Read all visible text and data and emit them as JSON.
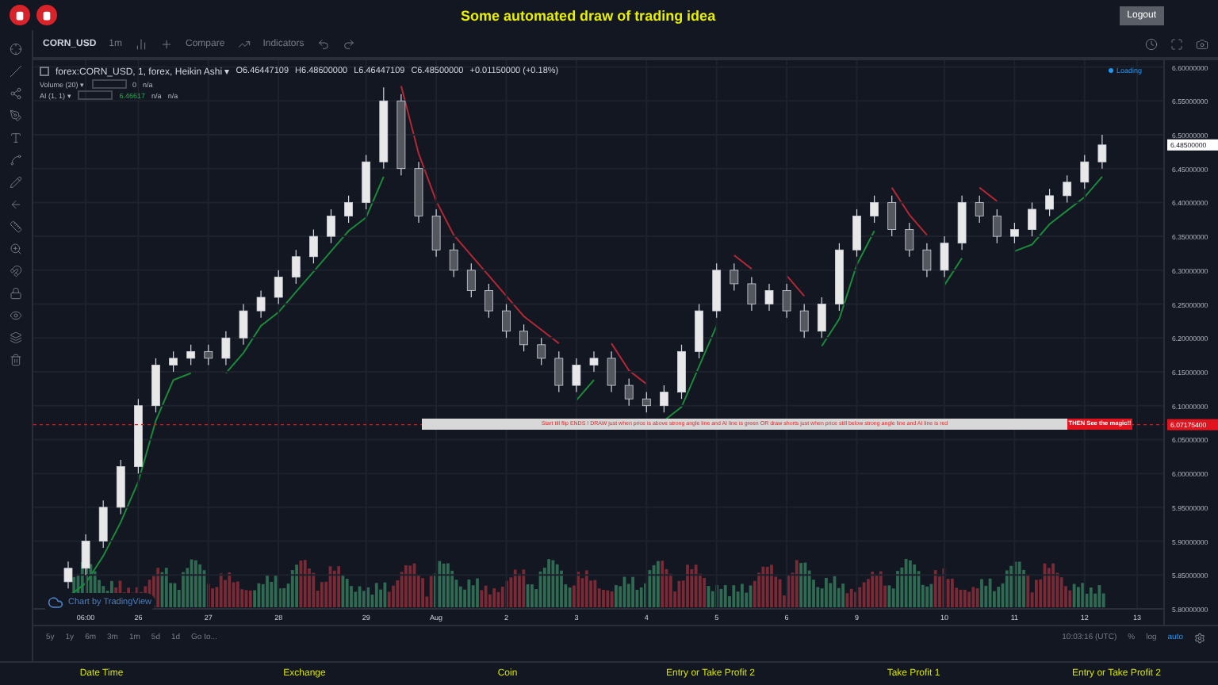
{
  "header": {
    "title": "Some automated draw of trading idea",
    "logout": "Logout"
  },
  "chart_toolbar": {
    "symbol": "CORN_USD",
    "interval": "1m",
    "compare": "Compare",
    "indicators": "Indicators"
  },
  "legend": {
    "series": "forex:CORN_USD, 1, forex, Heikin Ashi ▾",
    "open": "O6.46447109",
    "high": "H6.48600000",
    "low": "L6.46447109",
    "close": "C6.48500000",
    "change": "+0.01150000 (+0.18%)",
    "studies": [
      {
        "name": "Volume (20) ▾",
        "values": [
          "0",
          "n/a"
        ]
      },
      {
        "name": "AI (1, 1) ▾",
        "values": [
          "6.46617",
          "n/a",
          "n/a"
        ]
      }
    ]
  },
  "loading": "Loading",
  "chart": {
    "chart_data": {
      "type": "candlestick",
      "grid": true,
      "ylim": [
        5.8,
        6.61
      ],
      "categories": [
        null,
        "06:00",
        null,
        null,
        "26",
        null,
        null,
        null,
        "27",
        null,
        null,
        null,
        "28",
        null,
        null,
        null,
        null,
        "29",
        null,
        null,
        null,
        "Aug",
        null,
        null,
        null,
        "2",
        null,
        null,
        null,
        "3",
        null,
        null,
        null,
        "4",
        null,
        null,
        null,
        "5",
        null,
        null,
        null,
        "6",
        null,
        null,
        null,
        "9",
        null,
        null,
        null,
        null,
        "10",
        null,
        null,
        null,
        "11",
        null,
        null,
        null,
        "12",
        null,
        null,
        "13"
      ],
      "yticks": [
        {
          "value": 6.6,
          "label": "6.60000000"
        },
        {
          "value": 6.55,
          "label": "6.55000000"
        },
        {
          "value": 6.5,
          "label": "6.50000000"
        },
        {
          "value": 6.45,
          "label": "6.45000000"
        },
        {
          "value": 6.4,
          "label": "6.40000000"
        },
        {
          "value": 6.35,
          "label": "6.35000000"
        },
        {
          "value": 6.3,
          "label": "6.30000000"
        },
        {
          "value": 6.25,
          "label": "6.25000000"
        },
        {
          "value": 6.2,
          "label": "6.20000000"
        },
        {
          "value": 6.15,
          "label": "6.15000000"
        },
        {
          "value": 6.1,
          "label": "6.10000000"
        },
        {
          "value": 6.05,
          "label": "6.05000000"
        },
        {
          "value": 6.0,
          "label": "6.00000000"
        },
        {
          "value": 5.95,
          "label": "5.95000000"
        },
        {
          "value": 5.9,
          "label": "5.90000000"
        },
        {
          "value": 5.85,
          "label": "5.85000000"
        },
        {
          "value": 5.8,
          "label": "5.80000000"
        }
      ],
      "ohlc": [
        [
          5.84,
          5.87,
          5.83,
          5.86
        ],
        [
          5.86,
          5.91,
          5.85,
          5.9
        ],
        [
          5.9,
          5.96,
          5.89,
          5.95
        ],
        [
          5.95,
          6.02,
          5.94,
          6.01
        ],
        [
          6.01,
          6.11,
          6.0,
          6.1
        ],
        [
          6.1,
          6.17,
          6.09,
          6.16
        ],
        [
          6.16,
          6.18,
          6.15,
          6.17
        ],
        [
          6.17,
          6.19,
          6.16,
          6.18
        ],
        [
          6.18,
          6.19,
          6.16,
          6.17
        ],
        [
          6.17,
          6.21,
          6.16,
          6.2
        ],
        [
          6.2,
          6.25,
          6.19,
          6.24
        ],
        [
          6.24,
          6.27,
          6.23,
          6.26
        ],
        [
          6.26,
          6.3,
          6.25,
          6.29
        ],
        [
          6.29,
          6.33,
          6.28,
          6.32
        ],
        [
          6.32,
          6.36,
          6.31,
          6.35
        ],
        [
          6.35,
          6.39,
          6.34,
          6.38
        ],
        [
          6.38,
          6.41,
          6.37,
          6.4
        ],
        [
          6.4,
          6.47,
          6.39,
          6.46
        ],
        [
          6.46,
          6.57,
          6.45,
          6.55
        ],
        [
          6.55,
          6.56,
          6.44,
          6.45
        ],
        [
          6.45,
          6.46,
          6.37,
          6.38
        ],
        [
          6.38,
          6.39,
          6.32,
          6.33
        ],
        [
          6.33,
          6.34,
          6.29,
          6.3
        ],
        [
          6.3,
          6.31,
          6.26,
          6.27
        ],
        [
          6.27,
          6.28,
          6.23,
          6.24
        ],
        [
          6.24,
          6.25,
          6.2,
          6.21
        ],
        [
          6.21,
          6.22,
          6.18,
          6.19
        ],
        [
          6.19,
          6.2,
          6.16,
          6.17
        ],
        [
          6.17,
          6.18,
          6.12,
          6.13
        ],
        [
          6.13,
          6.17,
          6.12,
          6.16
        ],
        [
          6.16,
          6.18,
          6.15,
          6.17
        ],
        [
          6.17,
          6.18,
          6.12,
          6.13
        ],
        [
          6.13,
          6.14,
          6.1,
          6.11
        ],
        [
          6.11,
          6.12,
          6.09,
          6.1
        ],
        [
          6.1,
          6.13,
          6.09,
          6.12
        ],
        [
          6.12,
          6.19,
          6.11,
          6.18
        ],
        [
          6.18,
          6.25,
          6.17,
          6.24
        ],
        [
          6.24,
          6.31,
          6.23,
          6.3
        ],
        [
          6.3,
          6.31,
          6.27,
          6.28
        ],
        [
          6.28,
          6.29,
          6.24,
          6.25
        ],
        [
          6.25,
          6.28,
          6.24,
          6.27
        ],
        [
          6.27,
          6.28,
          6.23,
          6.24
        ],
        [
          6.24,
          6.25,
          6.2,
          6.21
        ],
        [
          6.21,
          6.26,
          6.2,
          6.25
        ],
        [
          6.25,
          6.34,
          6.24,
          6.33
        ],
        [
          6.33,
          6.39,
          6.32,
          6.38
        ],
        [
          6.38,
          6.41,
          6.37,
          6.4
        ],
        [
          6.4,
          6.41,
          6.35,
          6.36
        ],
        [
          6.36,
          6.37,
          6.32,
          6.33
        ],
        [
          6.33,
          6.34,
          6.29,
          6.3
        ],
        [
          6.3,
          6.35,
          6.29,
          6.34
        ],
        [
          6.34,
          6.41,
          6.33,
          6.4
        ],
        [
          6.4,
          6.41,
          6.37,
          6.38
        ],
        [
          6.38,
          6.39,
          6.34,
          6.35
        ],
        [
          6.35,
          6.37,
          6.34,
          6.36
        ],
        [
          6.36,
          6.4,
          6.35,
          6.39
        ],
        [
          6.39,
          6.42,
          6.38,
          6.41
        ],
        [
          6.41,
          6.44,
          6.4,
          6.43
        ],
        [
          6.43,
          6.47,
          6.42,
          6.46
        ],
        [
          6.46,
          6.5,
          6.45,
          6.485
        ],
        null,
        null
      ],
      "ref_lines": [
        {
          "axis": "y",
          "value": 6.072,
          "color": "#e0141e"
        }
      ]
    }
  },
  "price_axis": {
    "current_price": "6.48500000",
    "signal_price": "6.07175400"
  },
  "signal": {
    "text": "Start till flip ENDS !   DRAW just when  price is above strong angle line and AI line is green      OR       draw shorts just when price still below strong angle line and AI line is red",
    "callout": "THEN See the magic!!"
  },
  "watermark": "Chart by TradingView",
  "bottom_toolbar": {
    "ranges": [
      "5y",
      "1y",
      "6m",
      "3m",
      "1m",
      "5d",
      "1d"
    ],
    "goto": "Go to...",
    "time": "10:03:16 (UTC)",
    "percent": "%",
    "log": "log",
    "auto": "auto"
  },
  "footer": [
    "Date Time",
    "Exchange",
    "Coin",
    "Entry or Take Profit 2",
    "Take Profit 1",
    "Entry or Take Profit 2"
  ]
}
